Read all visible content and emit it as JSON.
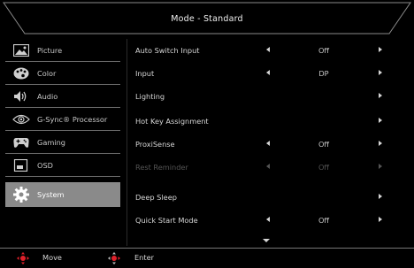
{
  "title": "Mode - Standard",
  "sidebar": {
    "items": [
      {
        "label": "Picture",
        "icon": "picture-icon",
        "active": false
      },
      {
        "label": "Color",
        "icon": "color-palette-icon",
        "active": false
      },
      {
        "label": "Audio",
        "icon": "speaker-icon",
        "active": false
      },
      {
        "label": "G-Sync® Processor",
        "icon": "gsync-eye-icon",
        "active": false
      },
      {
        "label": "Gaming",
        "icon": "gamepad-icon",
        "active": false
      },
      {
        "label": "OSD",
        "icon": "osd-window-icon",
        "active": false
      },
      {
        "label": "System",
        "icon": "gear-icon",
        "active": true
      }
    ]
  },
  "settings": [
    {
      "name": "Auto Switch Input",
      "value": "Off",
      "left_arrow": true,
      "right_arrow": true,
      "disabled": false
    },
    {
      "name": "Input",
      "value": "DP",
      "left_arrow": true,
      "right_arrow": true,
      "disabled": false
    },
    {
      "name": "Lighting",
      "value": "",
      "left_arrow": false,
      "right_arrow": true,
      "disabled": false
    },
    {
      "name": "Hot Key Assignment",
      "value": "",
      "left_arrow": false,
      "right_arrow": true,
      "disabled": false
    },
    {
      "name": "ProxiSense",
      "value": "Off",
      "left_arrow": true,
      "right_arrow": true,
      "disabled": false
    },
    {
      "name": "Rest Reminder",
      "value": "Off",
      "left_arrow": true,
      "right_arrow": true,
      "disabled": true
    },
    {
      "name": "Deep Sleep",
      "value": "",
      "left_arrow": false,
      "right_arrow": true,
      "disabled": false
    },
    {
      "name": "Quick Start Mode",
      "value": "Off",
      "left_arrow": true,
      "right_arrow": true,
      "disabled": false
    }
  ],
  "footer": {
    "move_label": "Move",
    "enter_label": "Enter"
  },
  "colors": {
    "background": "#000000",
    "active_item": "#8a8a8a",
    "joystick_red": "#e0202a",
    "disabled_text": "#555555"
  }
}
